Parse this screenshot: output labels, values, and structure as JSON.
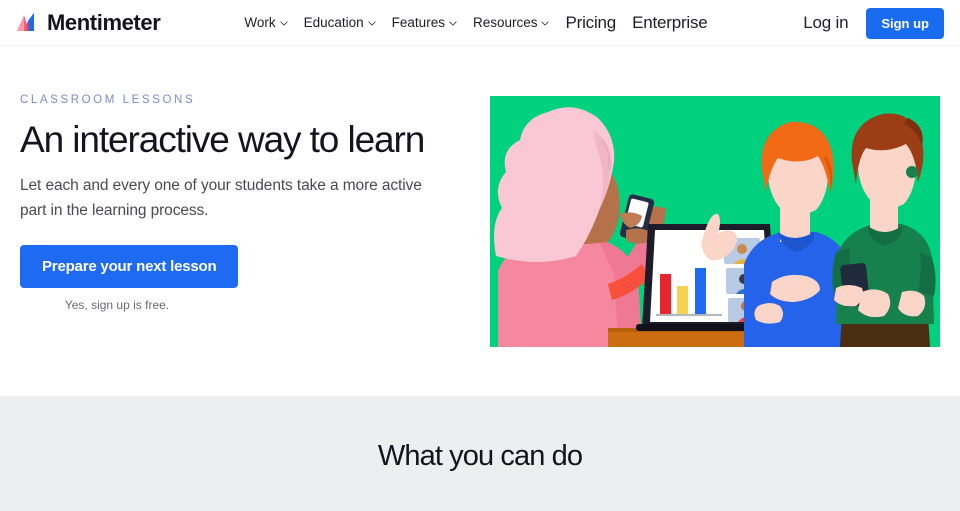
{
  "header": {
    "logo": {
      "icon": "mentimeter-logo-icon",
      "text": "Mentimeter"
    },
    "nav": [
      {
        "label": "Work",
        "has_dropdown": true
      },
      {
        "label": "Education",
        "has_dropdown": true
      },
      {
        "label": "Features",
        "has_dropdown": true
      },
      {
        "label": "Resources",
        "has_dropdown": true
      },
      {
        "label": "Pricing",
        "has_dropdown": false
      },
      {
        "label": "Enterprise",
        "has_dropdown": false
      }
    ],
    "login_label": "Log in",
    "signup_label": "Sign up",
    "accent_color": "#196cf0"
  },
  "hero": {
    "eyebrow": "CLASSROOM LESSONS",
    "eyebrow_color": "#7d8cc4",
    "title": "An interactive way to learn",
    "subtitle": "Let each and every one of your students take a more active part in the learning process.",
    "cta_label": "Prepare your next lesson",
    "cta_note": "Yes, sign up is free.",
    "cta_color": "#1f6af2",
    "illustration": {
      "name": "classroom-lesson-illustration",
      "background_color": "#00d17e",
      "description": "Three people around a laptop showing a live bar-chart poll with video participant tiles",
      "laptop_chart_bars": [
        "#e8252c",
        "#f5d24f",
        "#1f6af2"
      ],
      "desk_color": "#cc6d12"
    }
  },
  "band": {
    "title": "What you can do",
    "background_color": "#eceef0"
  }
}
